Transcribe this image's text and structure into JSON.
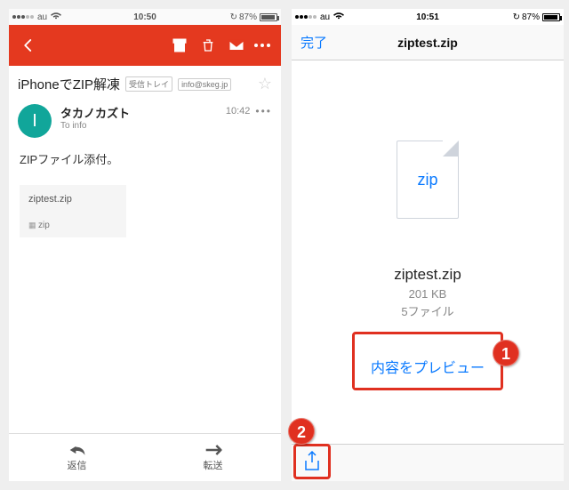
{
  "left": {
    "status": {
      "carrier": "au",
      "time": "10:50",
      "battery": "87%"
    },
    "subject": "iPhoneでZIP解凍",
    "chips": [
      "受信トレイ",
      "info@skeg.jp"
    ],
    "sender": {
      "initial": "I",
      "name": "タカノカズト",
      "to": "To info",
      "time": "10:42"
    },
    "body": "ZIPファイル添付。",
    "attachment": {
      "filename": "ziptest.zip",
      "type": "zip"
    },
    "reply": {
      "reply": "返信",
      "forward": "転送"
    }
  },
  "right": {
    "status": {
      "carrier": "au",
      "time": "10:51",
      "battery": "87%"
    },
    "done": "完了",
    "title": "ziptest.zip",
    "doc_label": "zip",
    "file": {
      "name": "ziptest.zip",
      "size": "201 KB",
      "count": "5ファイル"
    },
    "preview_button": "内容をプレビュー",
    "annotations": {
      "one": "1",
      "two": "2"
    }
  }
}
